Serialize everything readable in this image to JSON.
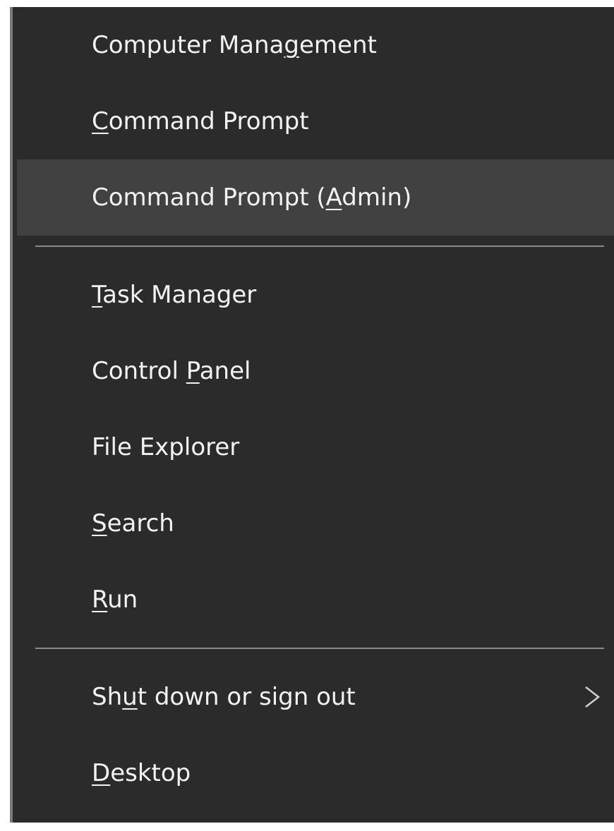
{
  "menu": {
    "items": [
      {
        "pre": "Computer Mana",
        "u": "g",
        "post": "ement"
      },
      {
        "pre": "",
        "u": "C",
        "post": "ommand Prompt"
      },
      {
        "pre": "Command Prompt (",
        "u": "A",
        "post": "dmin)"
      },
      {
        "pre": "",
        "u": "T",
        "post": "ask Manager"
      },
      {
        "pre": "Control ",
        "u": "P",
        "post": "anel"
      },
      {
        "pre": "File Explorer",
        "u": "",
        "post": ""
      },
      {
        "pre": "",
        "u": "S",
        "post": "earch"
      },
      {
        "pre": "",
        "u": "R",
        "post": "un"
      },
      {
        "pre": "Sh",
        "u": "u",
        "post": "t down or sign out"
      },
      {
        "pre": "",
        "u": "D",
        "post": "esktop"
      }
    ],
    "highlighted_index": 2,
    "submenu_indicator": "chevron-right-icon",
    "colors": {
      "background": "#2b2b2b",
      "highlight": "#414141",
      "text": "#f2f2f2",
      "separator": "#8a8a8a"
    }
  }
}
